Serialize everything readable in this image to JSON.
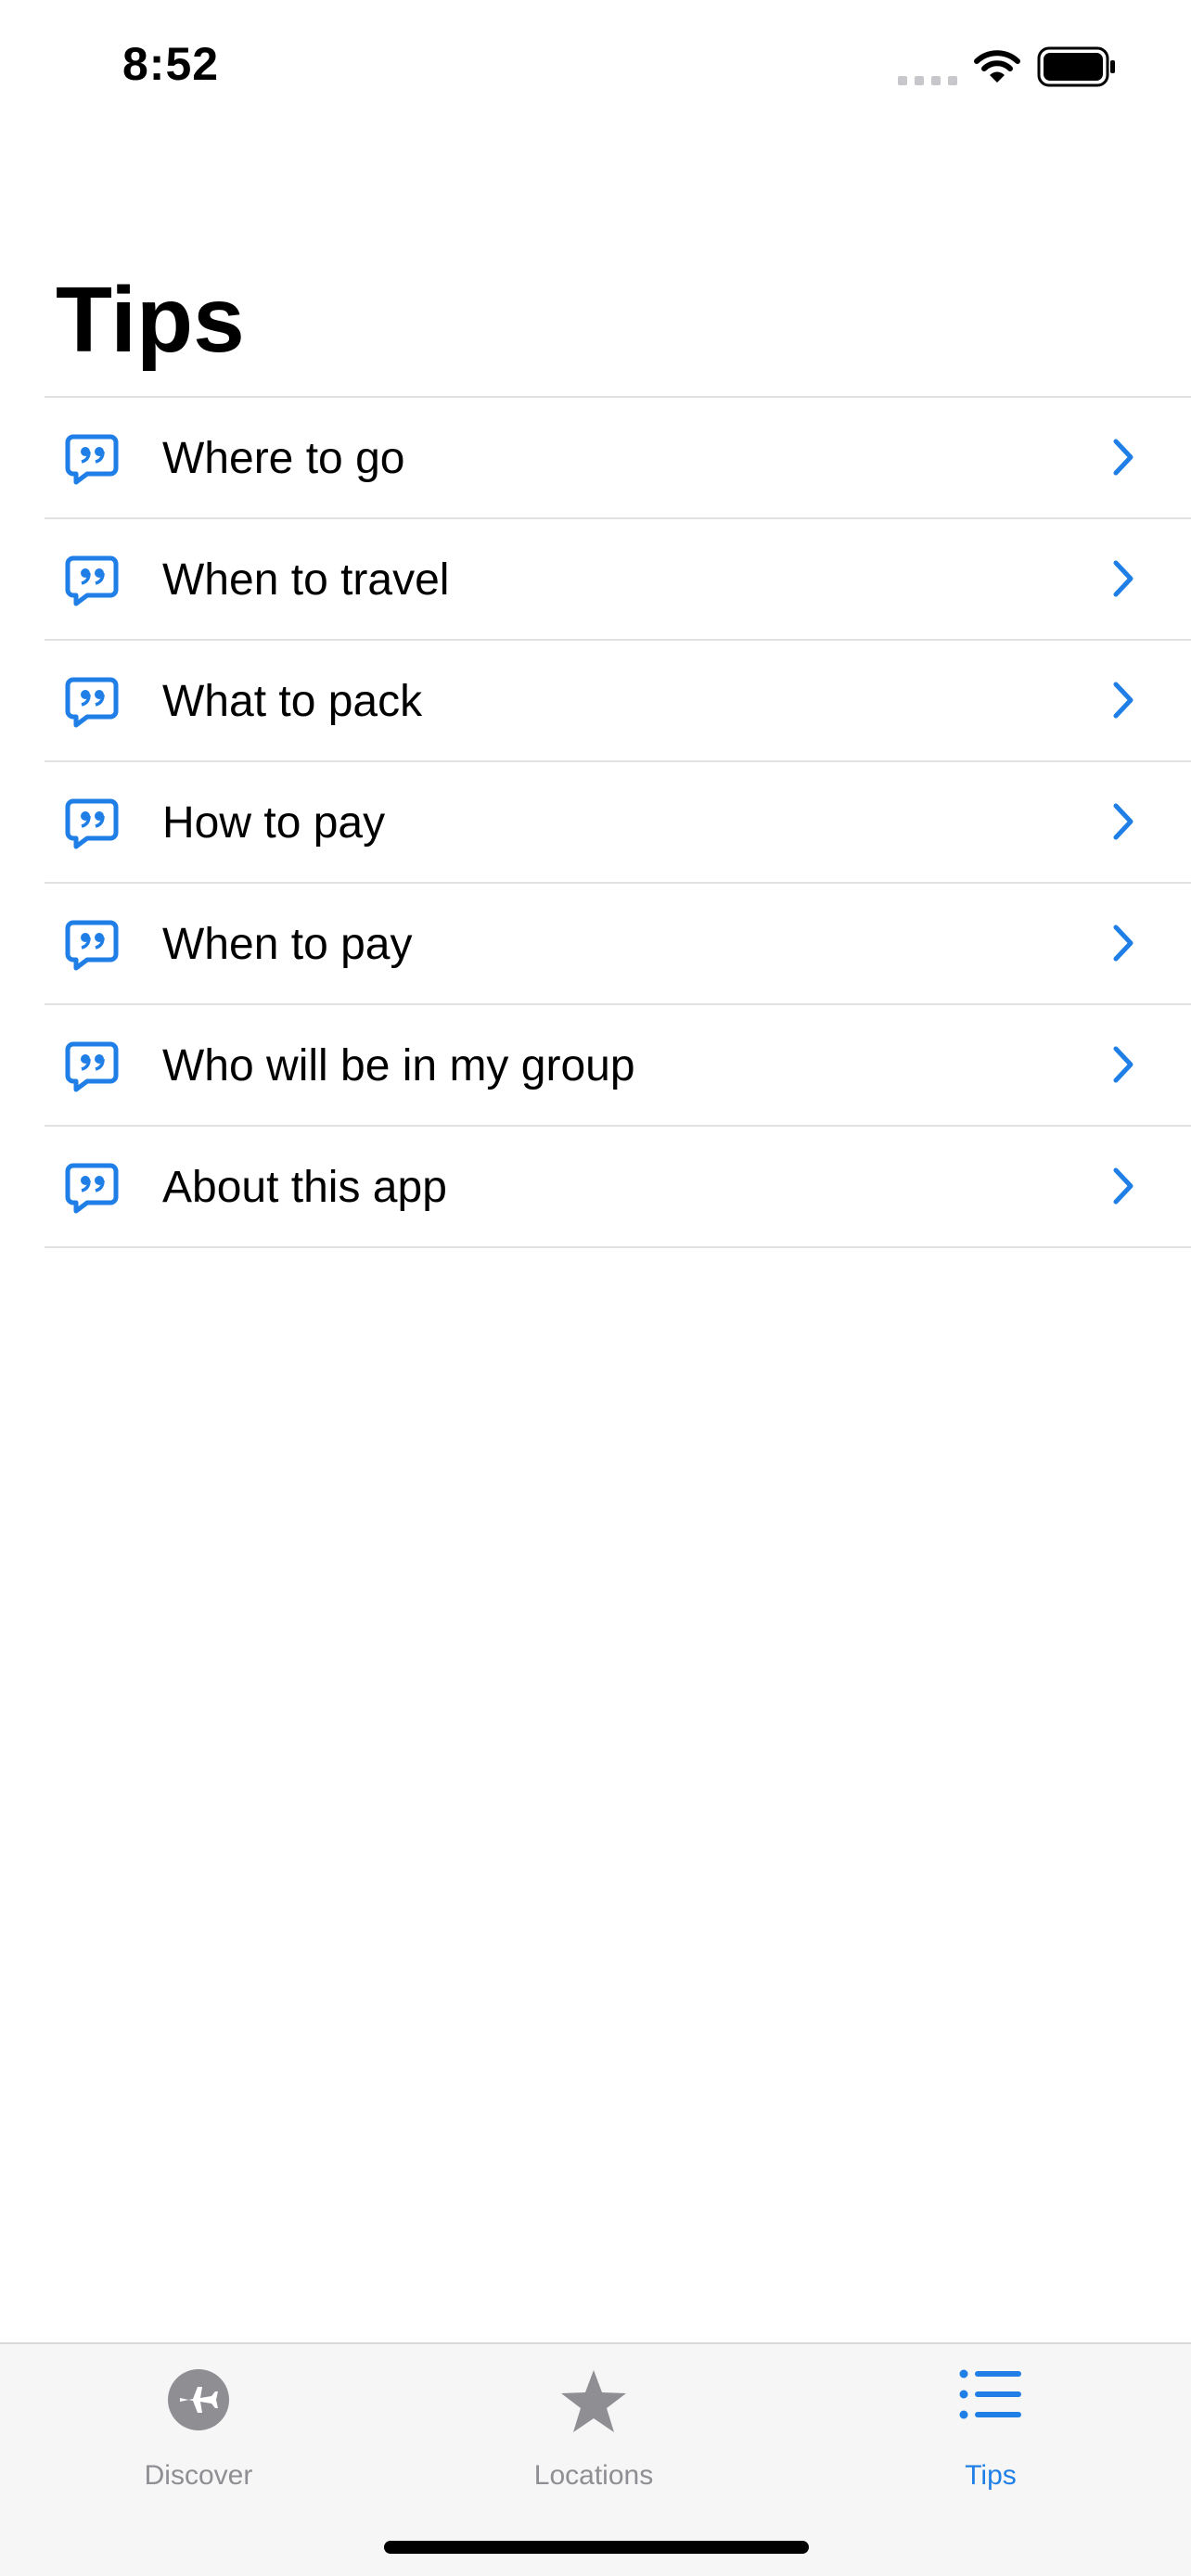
{
  "status_bar": {
    "time": "8:52"
  },
  "page": {
    "title": "Tips"
  },
  "tips": [
    {
      "label": "Where to go"
    },
    {
      "label": "When to travel"
    },
    {
      "label": "What to pack"
    },
    {
      "label": "How to pay"
    },
    {
      "label": "When to pay"
    },
    {
      "label": "Who will be in my group"
    },
    {
      "label": "About this app"
    }
  ],
  "tab_bar": {
    "tabs": [
      {
        "label": "Discover",
        "icon": "airplane-circle-icon",
        "active": false
      },
      {
        "label": "Locations",
        "icon": "star-icon",
        "active": false
      },
      {
        "label": "Tips",
        "icon": "list-bullet-icon",
        "active": true
      }
    ]
  },
  "colors": {
    "accent": "#1f7fe6",
    "inactive": "#8e8e93",
    "separator": "#e1e1e4"
  }
}
